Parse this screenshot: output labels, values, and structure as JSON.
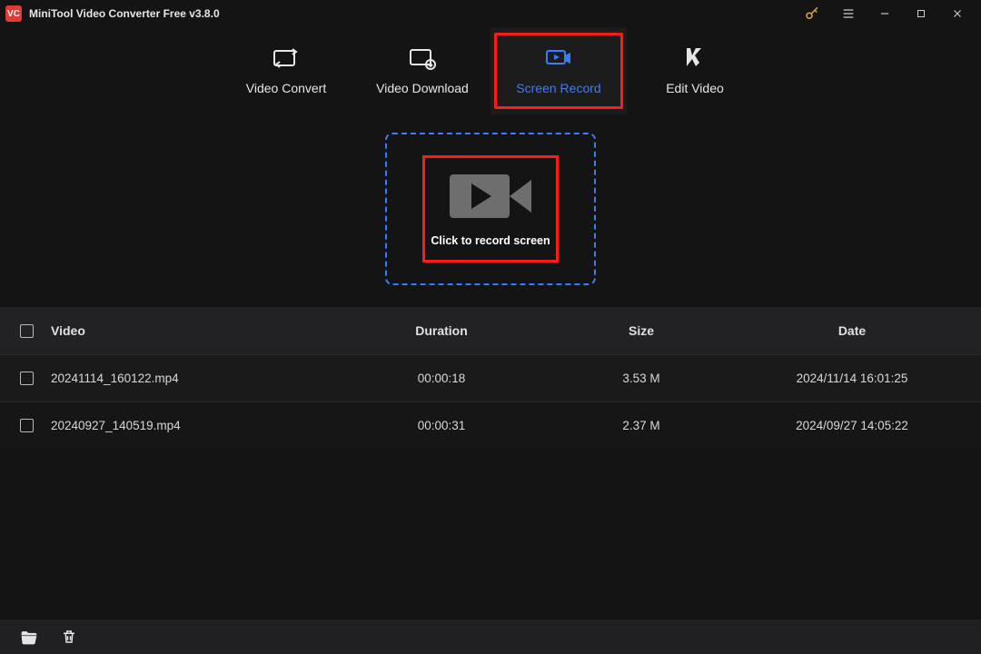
{
  "titlebar": {
    "title": "MiniTool Video Converter Free v3.8.0"
  },
  "tabs": {
    "convert": {
      "label": "Video Convert"
    },
    "download": {
      "label": "Video Download"
    },
    "record": {
      "label": "Screen Record"
    },
    "edit": {
      "label": "Edit Video"
    }
  },
  "record_panel": {
    "cta": "Click to record screen"
  },
  "table": {
    "headers": {
      "video": "Video",
      "duration": "Duration",
      "size": "Size",
      "date": "Date"
    },
    "rows": [
      {
        "video": "20241114_160122.mp4",
        "duration": "00:00:18",
        "size": "3.53 M",
        "date": "2024/11/14 16:01:25"
      },
      {
        "video": "20240927_140519.mp4",
        "duration": "00:00:31",
        "size": "2.37 M",
        "date": "2024/09/27 14:05:22"
      }
    ]
  }
}
